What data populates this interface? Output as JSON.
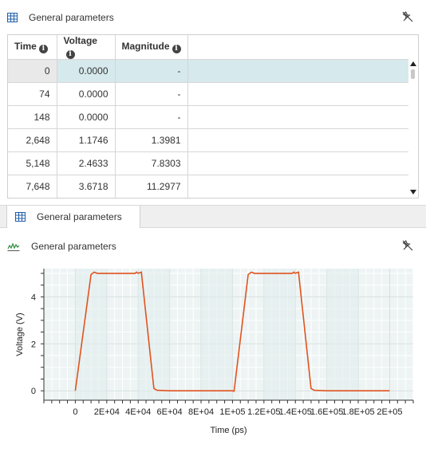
{
  "top_panel": {
    "title": "General parameters",
    "icon": "table-icon",
    "pin_icon": "pin-icon"
  },
  "table": {
    "columns": [
      "Time",
      "Voltage",
      "Magnitude"
    ],
    "rows": [
      {
        "time": "0",
        "voltage": "0.0000",
        "magnitude": "-"
      },
      {
        "time": "74",
        "voltage": "0.0000",
        "magnitude": "-"
      },
      {
        "time": "148",
        "voltage": "0.0000",
        "magnitude": "-"
      },
      {
        "time": "2,648",
        "voltage": "1.1746",
        "magnitude": "1.3981"
      },
      {
        "time": "5,148",
        "voltage": "2.4633",
        "magnitude": "7.8303"
      },
      {
        "time": "7,648",
        "voltage": "3.6718",
        "magnitude": "11.2977"
      }
    ]
  },
  "tab": {
    "label": "General parameters",
    "icon": "table-icon"
  },
  "bottom_panel": {
    "title": "General parameters",
    "icon": "line-chart-icon",
    "pin_icon": "pin-icon"
  },
  "chart_data": {
    "type": "line",
    "xlabel": "Time (ps)",
    "ylabel": "Voltage (V)",
    "xlim": [
      -20000,
      215000
    ],
    "ylim": [
      -0.4,
      5.2
    ],
    "x_ticks": [
      0,
      20000,
      40000,
      60000,
      80000,
      100000,
      120000,
      140000,
      160000,
      180000,
      200000
    ],
    "x_tick_labels": [
      "0",
      "2E+04",
      "4E+04",
      "6E+04",
      "8E+04",
      "1E+05",
      "1.2E+05",
      "1.4E+05",
      "1.6E+05",
      "1.8E+05",
      "2E+05"
    ],
    "y_ticks": [
      0,
      2,
      4
    ],
    "y_tick_labels": [
      "0",
      "2",
      "4"
    ],
    "grid": true,
    "color": "#e0531f",
    "series": [
      {
        "x": [
          0,
          10000,
          12000,
          14000,
          38000,
          39000,
          40000,
          42000,
          50000,
          52000,
          60000,
          100000,
          101000,
          110000,
          112000,
          114000,
          138000,
          139000,
          140000,
          142000,
          150000,
          152000,
          160000,
          200000
        ],
        "y": [
          0,
          4.95,
          5.05,
          5.0,
          5.0,
          5.05,
          5.0,
          5.05,
          0.1,
          0.02,
          0,
          0,
          -0.02,
          4.95,
          5.05,
          5.0,
          5.0,
          5.05,
          5.0,
          5.05,
          0.1,
          0.02,
          0,
          0
        ]
      }
    ]
  }
}
